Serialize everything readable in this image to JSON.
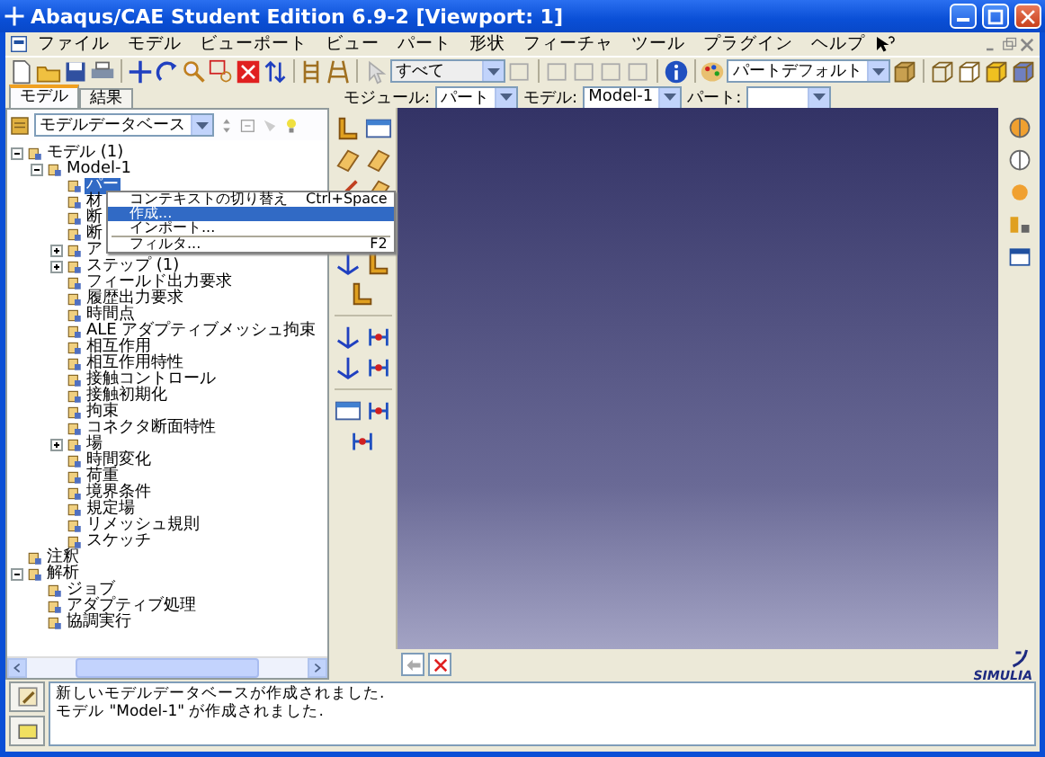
{
  "window": {
    "title": "Abaqus/CAE Student Edition 6.9-2 [Viewport: 1]"
  },
  "menu_bar": [
    "ファイル",
    "モデル",
    "ビューポート",
    "ビュー",
    "パート",
    "形状",
    "フィーチャ",
    "ツール",
    "プラグイン",
    "ヘルプ"
  ],
  "toolbar": {
    "selection_filter": "すべて",
    "render_style": "パートデフォルト"
  },
  "tabs": [
    {
      "label": "モデル",
      "selected": true
    },
    {
      "label": "結果",
      "selected": false
    }
  ],
  "context_bar": {
    "module_label": "モジュール:",
    "module": "パート",
    "model_label": "モデル:",
    "model": "Model-1",
    "part_label": "パート:"
  },
  "tree_header": {
    "selector": "モデルデータベース"
  },
  "tree": [
    {
      "label": "モデル (1)",
      "expanded": true,
      "selected": false,
      "children": [
        {
          "label": "Model-1",
          "expanded": true,
          "selected": false,
          "children": [
            {
              "label": "パー",
              "selected": true
            },
            {
              "label": "材",
              "selected": false
            },
            {
              "label": "断",
              "selected": false
            },
            {
              "label": "断",
              "selected": false
            },
            {
              "label": "ア",
              "expanded": false,
              "selected": false
            },
            {
              "label": "ステップ (1)",
              "expanded": false,
              "selected": false
            },
            {
              "label": "フィールド出力要求",
              "selected": false
            },
            {
              "label": "履歴出力要求",
              "selected": false
            },
            {
              "label": "時間点",
              "selected": false
            },
            {
              "label": "ALE アダプティブメッシュ拘束",
              "selected": false
            },
            {
              "label": "相互作用",
              "selected": false
            },
            {
              "label": "相互作用特性",
              "selected": false
            },
            {
              "label": "接触コントロール",
              "selected": false
            },
            {
              "label": "接触初期化",
              "selected": false
            },
            {
              "label": "拘束",
              "selected": false
            },
            {
              "label": "コネクタ断面特性",
              "selected": false
            },
            {
              "label": "場",
              "expanded": false,
              "selected": false
            },
            {
              "label": "時間変化",
              "selected": false
            },
            {
              "label": "荷重",
              "selected": false
            },
            {
              "label": "境界条件",
              "selected": false
            },
            {
              "label": "規定場",
              "selected": false
            },
            {
              "label": "リメッシュ規則",
              "selected": false
            },
            {
              "label": "スケッチ",
              "selected": false
            }
          ]
        }
      ]
    },
    {
      "label": "注釈",
      "selected": false
    },
    {
      "label": "解析",
      "expanded": true,
      "selected": false,
      "children": [
        {
          "label": "ジョブ",
          "selected": false
        },
        {
          "label": "アダプティブ処理",
          "selected": false
        },
        {
          "label": "協調実行",
          "selected": false
        }
      ]
    }
  ],
  "context_menu": [
    {
      "label": "コンテキストの切り替え",
      "shortcut": "Ctrl+Space",
      "selected": false
    },
    {
      "label": "作成...",
      "selected": true
    },
    {
      "label": "インポート...",
      "selected": false
    },
    {
      "label": "フィルタ...",
      "shortcut": "F2",
      "selected": false
    }
  ],
  "logo": {
    "text": "SIMULIA"
  },
  "messages": [
    "新しいモデルデータベースが作成されました.",
    "モデル \"Model-1\" が作成されました."
  ]
}
